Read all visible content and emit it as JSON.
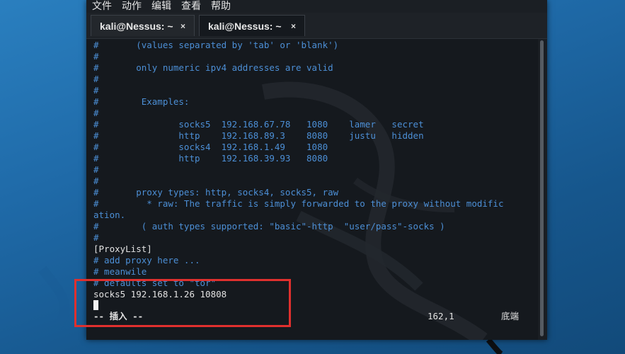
{
  "menu": [
    "文件",
    "动作",
    "编辑",
    "查看",
    "帮助"
  ],
  "tabs": [
    {
      "label": "kali@Nessus: ~",
      "close": "×",
      "active": false
    },
    {
      "label": "kali@Nessus: ~",
      "close": "×",
      "active": true
    }
  ],
  "terminal": {
    "lines": [
      {
        "text": "#       (values separated by 'tab' or 'blank')",
        "style": "comment"
      },
      {
        "text": "#",
        "style": "comment"
      },
      {
        "text": "#       only numeric ipv4 addresses are valid",
        "style": "comment"
      },
      {
        "text": "#",
        "style": "comment"
      },
      {
        "text": "#",
        "style": "comment"
      },
      {
        "text": "#        Examples:",
        "style": "comment"
      },
      {
        "text": "#",
        "style": "comment"
      },
      {
        "text": "#               socks5  192.168.67.78   1080    lamer   secret",
        "style": "comment"
      },
      {
        "text": "#               http    192.168.89.3    8080    justu   hidden",
        "style": "comment"
      },
      {
        "text": "#               socks4  192.168.1.49    1080",
        "style": "comment"
      },
      {
        "text": "#               http    192.168.39.93   8080",
        "style": "comment"
      },
      {
        "text": "#",
        "style": "comment"
      },
      {
        "text": "#",
        "style": "comment"
      },
      {
        "text": "#       proxy types: http, socks4, socks5, raw",
        "style": "comment"
      },
      {
        "text": "#         * raw: The traffic is simply forwarded to the proxy without modific",
        "style": "comment"
      },
      {
        "text": "ation.",
        "style": "comment"
      },
      {
        "text": "#        ( auth types supported: \"basic\"-http  \"user/pass\"-socks )",
        "style": "comment"
      },
      {
        "text": "#",
        "style": "comment"
      },
      {
        "text": "[ProxyList]",
        "style": "plain"
      },
      {
        "text": "# add proxy here ...",
        "style": "comment"
      },
      {
        "text": "# meanwile",
        "style": "comment"
      },
      {
        "text": "# defaults set to \"tor\"",
        "style": "comment"
      },
      {
        "text": "socks5 192.168.1.26 10808",
        "style": "plain"
      }
    ],
    "status": {
      "mode": "-- 插入 --",
      "position": "162,1",
      "scroll": "底端"
    }
  },
  "colors": {
    "comment": "#4c8fd6",
    "text": "#e2e2e2",
    "highlight": "#e0302e"
  }
}
